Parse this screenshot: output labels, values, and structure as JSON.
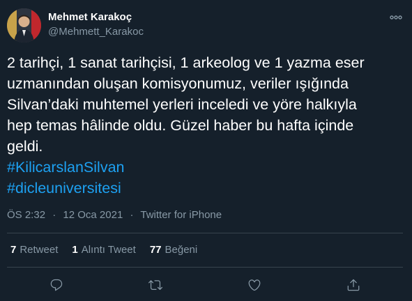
{
  "user": {
    "display_name": "Mehmet Karakoç",
    "handle": "@Mehmett_Karakoc"
  },
  "tweet": {
    "lines": [
      "2 tarihçi, 1 sanat tarihçisi, 1 arkeolog ve 1 yazma eser",
      "uzmanından oluşan komisyonumuz, veriler ışığında",
      "Silvan’daki muhtemel yerleri inceledi ve yöre halkıyla",
      "hep temas hâlinde oldu. Güzel haber bu hafta içinde",
      "geldi."
    ],
    "hashtags": [
      "#KilicarslanSilvan",
      "#dicleuniversitesi"
    ]
  },
  "meta": {
    "time": "ÖS 2:32",
    "date": "12 Oca 2021",
    "separator": "·",
    "source": "Twitter for iPhone"
  },
  "stats": {
    "retweets_count": "7",
    "retweets_label": "Retweet",
    "quotes_count": "1",
    "quotes_label": "Alıntı Tweet",
    "likes_count": "77",
    "likes_label": "Beğeni"
  },
  "actions": [
    "reply-icon",
    "retweet-icon",
    "like-icon",
    "share-icon"
  ],
  "colors": {
    "background": "#15202b",
    "text": "#ffffff",
    "secondary": "#8899a6",
    "link": "#1da1f2",
    "divider": "#38444d"
  }
}
